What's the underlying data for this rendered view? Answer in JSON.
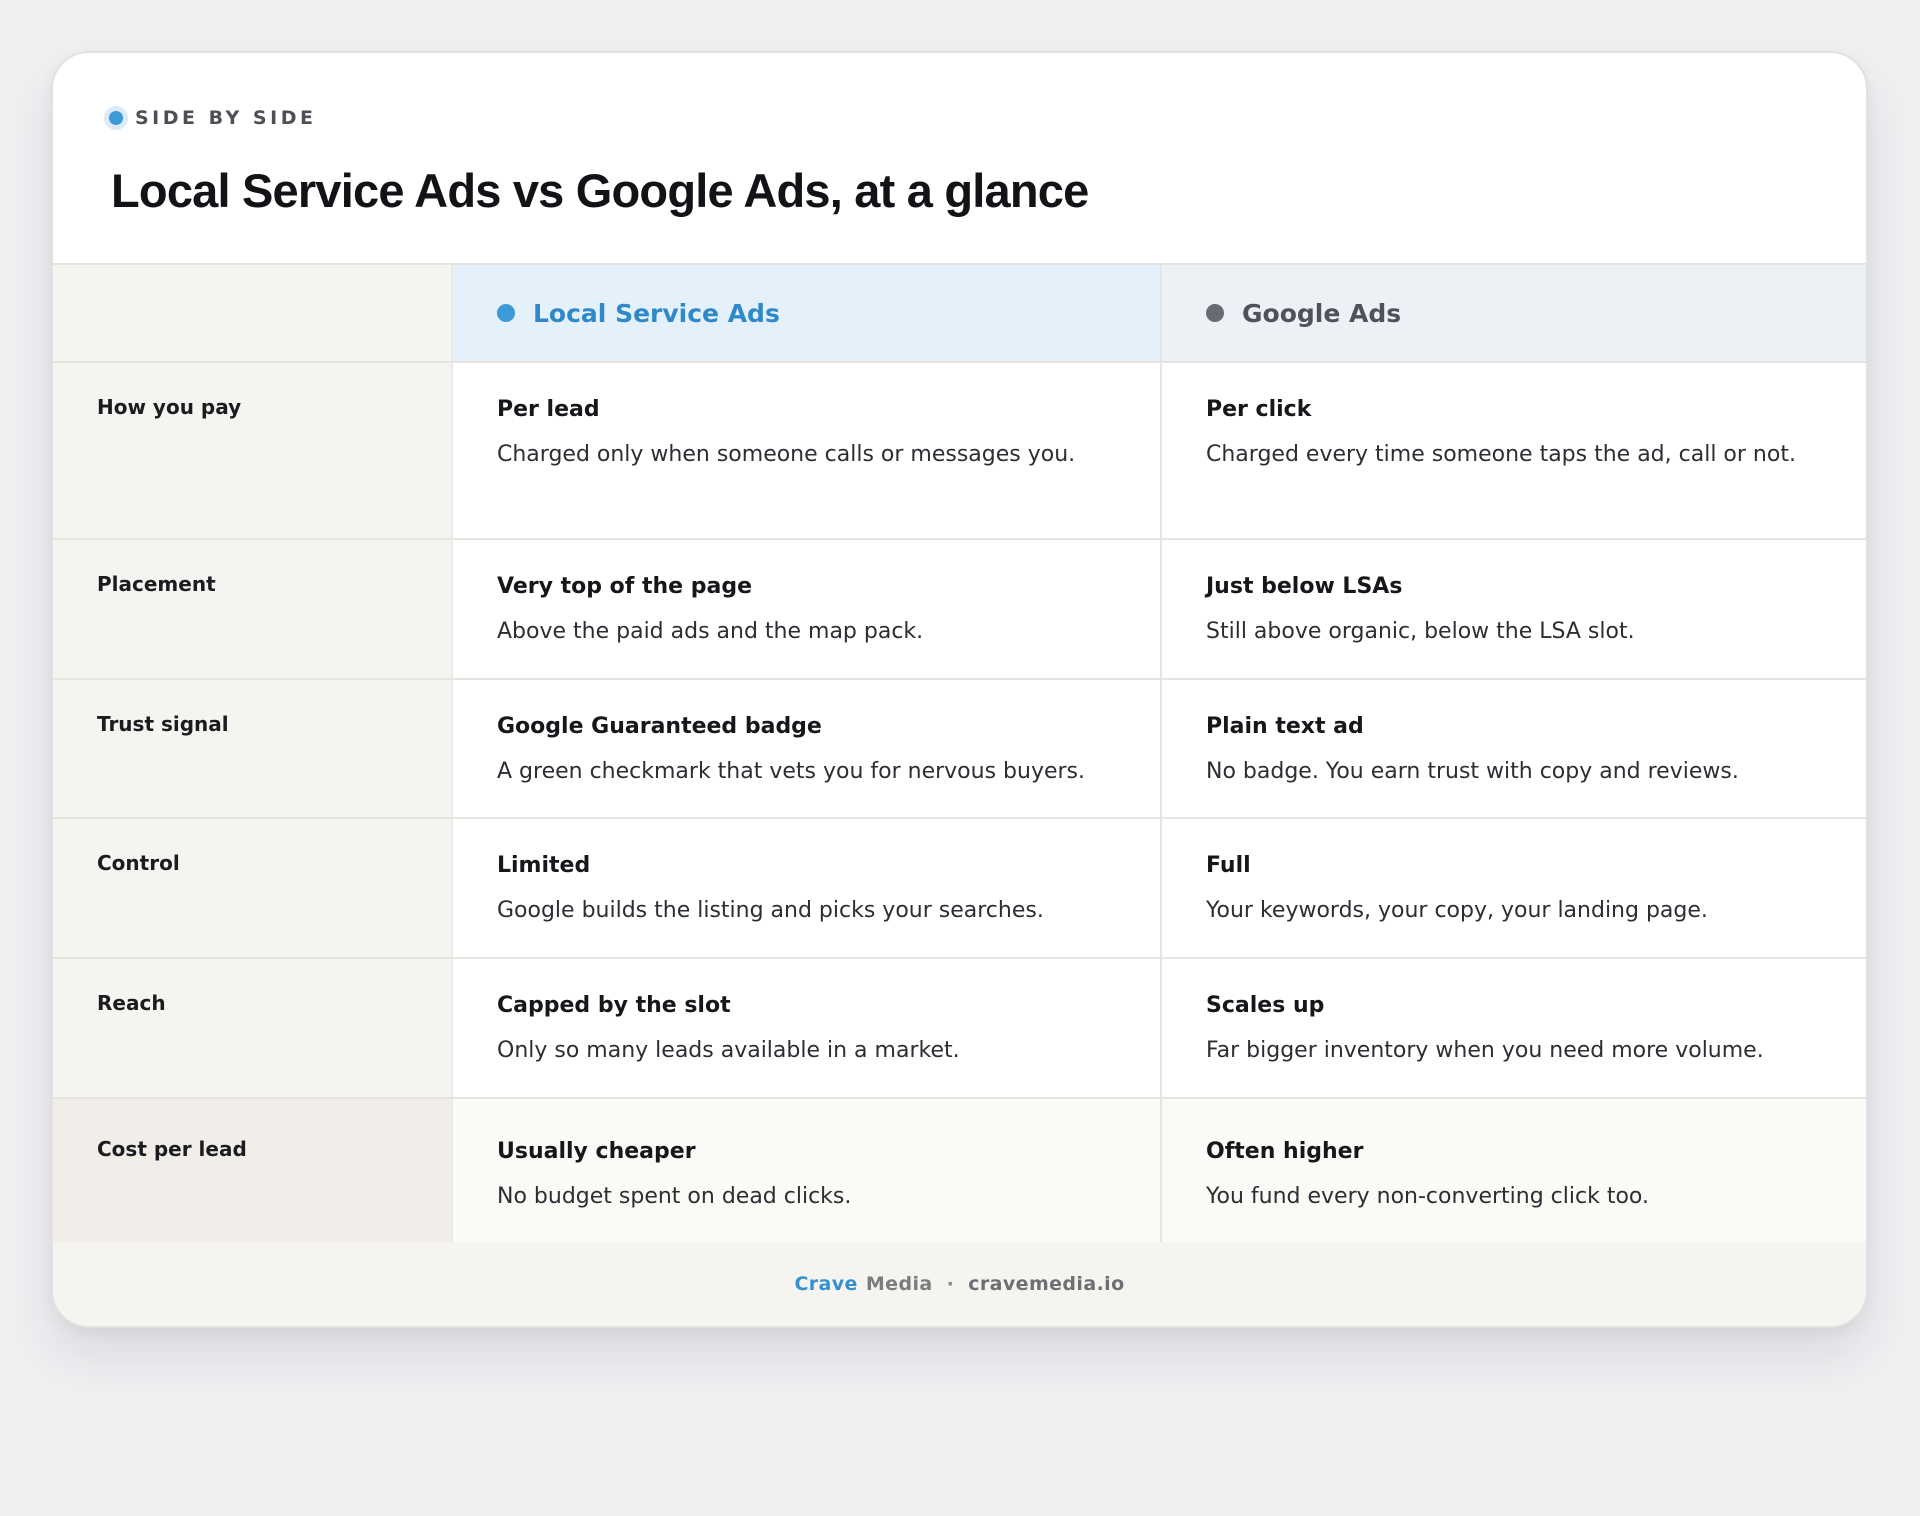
{
  "header": {
    "eyebrow": "SIDE BY SIDE",
    "title": "Local Service Ads vs Google Ads, at a glance"
  },
  "columns": {
    "lsa": {
      "label": "Local Service Ads",
      "color": "#3d9ad9"
    },
    "gads": {
      "label": "Google Ads",
      "color": "#666b74"
    }
  },
  "rows": [
    {
      "label": "How you pay",
      "lsa": {
        "title": "Per lead",
        "desc": "Charged only when someone calls or messages you."
      },
      "gads": {
        "title": "Per click",
        "desc": "Charged every time someone taps the ad, call or not."
      }
    },
    {
      "label": "Placement",
      "lsa": {
        "title": "Very top of the page",
        "desc": "Above the paid ads and the map pack."
      },
      "gads": {
        "title": "Just below LSAs",
        "desc": "Still above organic, below the LSA slot."
      }
    },
    {
      "label": "Trust signal",
      "lsa": {
        "title": "Google Guaranteed badge",
        "desc": "A green checkmark that vets you for nervous buyers."
      },
      "gads": {
        "title": "Plain text ad",
        "desc": "No badge. You earn trust with copy and reviews."
      }
    },
    {
      "label": "Control",
      "lsa": {
        "title": "Limited",
        "desc": "Google builds the listing and picks your searches."
      },
      "gads": {
        "title": "Full",
        "desc": "Your keywords, your copy, your landing page."
      }
    },
    {
      "label": "Reach",
      "lsa": {
        "title": "Capped by the slot",
        "desc": "Only so many leads available in a market."
      },
      "gads": {
        "title": "Scales up",
        "desc": "Far bigger inventory when you need more volume."
      }
    },
    {
      "label": "Cost per lead",
      "lsa": {
        "title": "Usually cheaper",
        "desc": "No budget spent on dead clicks."
      },
      "gads": {
        "title": "Often higher",
        "desc": "You fund every non-converting click too."
      }
    }
  ],
  "footer": {
    "brand_primary": "Crave",
    "brand_secondary": "Media",
    "separator": "·",
    "site": "cravemedia.io"
  }
}
